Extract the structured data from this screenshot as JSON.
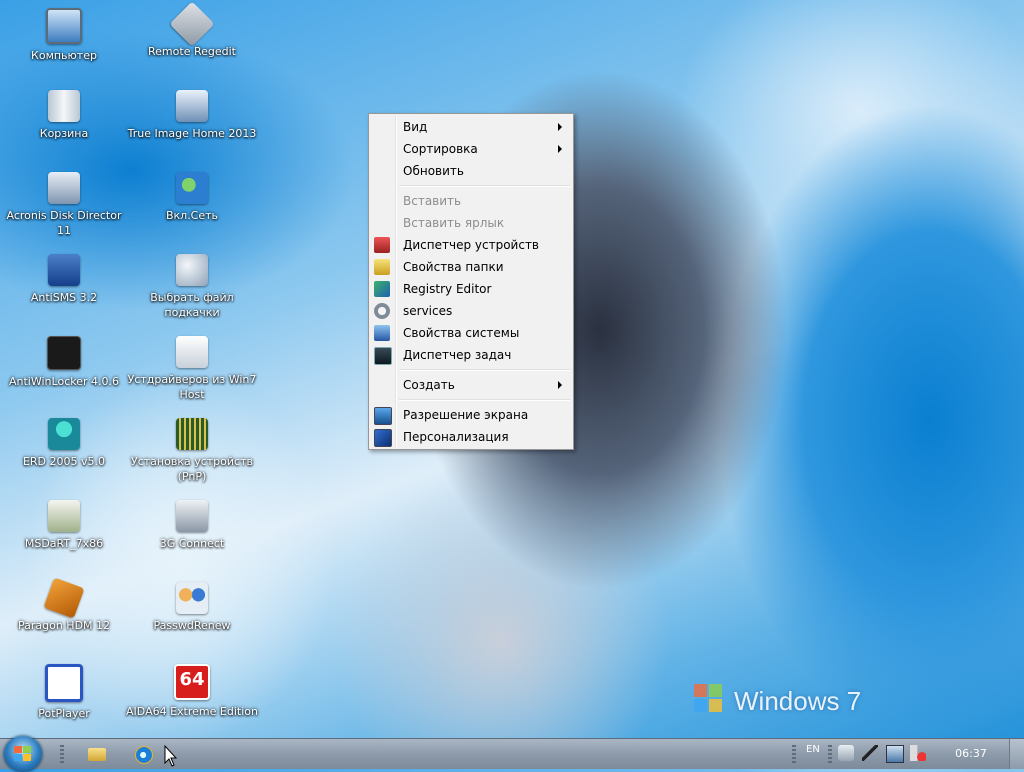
{
  "desktop_icons": {
    "computer": "Компьютер",
    "recycle_bin": "Корзина",
    "acronis": "Acronis Disk Director 11",
    "antisms": "AntiSMS 3.2",
    "antiwinlocker": "AntiWinLocker 4.0.6",
    "erd": "ERD 2005 v5.0",
    "msdart": "MSDaRT_7x86",
    "paragon": "Paragon HDM 12",
    "potplayer": "PotPlayer",
    "remote_regedit": "Remote Regedit",
    "true_image": "True Image Home 2013",
    "network": "Вкл.Сеть",
    "pagefile": "Выбрать файл подкачки",
    "drivers": "Устдрайверов из Win7 Host",
    "pnp": "Установка устройств (PnP)",
    "connect3g": "3G Connect",
    "passwdrenew": "PasswdRenew",
    "aida64": "AIDA64 Extreme Edition",
    "aida64_badge": "64"
  },
  "context_menu": {
    "view": "Вид",
    "sort": "Сортировка",
    "refresh": "Обновить",
    "paste": "Вставить",
    "paste_shortcut": "Вставить ярлык",
    "device_manager": "Диспетчер устройств",
    "folder_options": "Свойства папки",
    "registry_editor": "Registry Editor",
    "services": "services",
    "system_properties": "Свойства системы",
    "task_manager": "Диспетчер задач",
    "create": "Создать",
    "screen_resolution": "Разрешение экрана",
    "personalization": "Персонализация"
  },
  "watermark": {
    "text": "Windows 7"
  },
  "taskbar": {
    "language": "EN",
    "clock": "06:37"
  },
  "colors": {
    "menu_bg": "#f1f1f1",
    "disabled_text": "#8d8d8d",
    "taskbar": "#8d9baa"
  },
  "icons": [
    "computer-icon",
    "recycle-bin-icon",
    "acronis-icon",
    "antisms-icon",
    "lock-icon",
    "erd-icon",
    "msdart-icon",
    "paragon-icon",
    "potplayer-icon",
    "regedit-icon",
    "true-image-icon",
    "network-icon",
    "pagefile-icon",
    "drivers-icon",
    "pnp-icon",
    "3g-icon",
    "passwdrenew-icon",
    "aida64-icon",
    "windows-logo-icon",
    "explorer-icon",
    "ie-icon"
  ]
}
